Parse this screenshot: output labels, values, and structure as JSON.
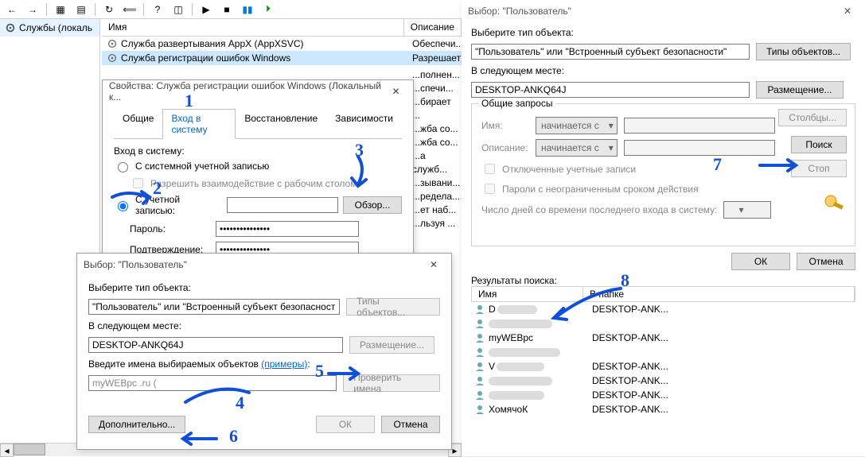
{
  "toolbar_icons": [
    "←",
    "→",
    "|",
    "▦",
    "▤",
    "|",
    "↻",
    "⟸",
    "|",
    "?",
    "◫",
    "|",
    "▶",
    "■",
    "⏸",
    "⏵"
  ],
  "left": {
    "node": "Службы (локаль"
  },
  "svc": {
    "col_name": "Имя",
    "col_desc": "Описание",
    "rows": [
      {
        "name": "Служба развертывания AppX (AppXSVC)",
        "desc": "Обеспечи..."
      },
      {
        "name": "Служба регистрации ошибок Windows",
        "desc": "Разрешает",
        "sel": true
      }
    ],
    "desc_frag": [
      "...полнен...",
      "...спечи...",
      "...бирает ...",
      "...жба со...",
      "...жба со...",
      "...а служб...",
      "...зывани...",
      "...редела...",
      "...ет наб...",
      "...льзуя ..."
    ]
  },
  "props": {
    "title": "Свойства: Служба регистрации ошибок Windows (Локальный к...",
    "tabs": {
      "general": "Общие",
      "logon": "Вход в систему",
      "recovery": "Восстановление",
      "deps": "Зависимости"
    },
    "logon_label": "Вход в систему:",
    "system_acct": "С системной учетной записью",
    "interact": "Разрешить взаимодействие с рабочим столом",
    "this_acct": "С учетной записью:",
    "browse": "Обзор...",
    "password": "Пароль:",
    "confirm": "Подтверждение:",
    "pwd_mask": "●●●●●●●●●●●●●●●"
  },
  "seluser1": {
    "title": "Выбор: \"Пользователь\"",
    "obj_type_lbl": "Выберите тип объекта:",
    "obj_type": "\"Пользователь\" или \"Встроенный субъект безопасности\"",
    "types_btn": "Типы объектов...",
    "loc_lbl": "В следующем месте:",
    "loc": "DESKTOP-ANKQ64J",
    "loc_btn": "Размещение...",
    "names_lbl": "Введите имена выбираемых объектов",
    "examples": "(примеры)",
    "names_val": "myWEBpc .ru (",
    "check_btn": "Проверить имена",
    "advanced": "Дополнительно...",
    "ok": "ОК",
    "cancel": "Отмена"
  },
  "seluser2": {
    "title": "Выбор: \"Пользователь\"",
    "obj_type_lbl": "Выберите тип объекта:",
    "obj_type": "\"Пользователь\" или \"Встроенный субъект безопасности\"",
    "types_btn": "Типы объектов...",
    "loc_lbl": "В следующем месте:",
    "loc": "DESKTOP-ANKQ64J",
    "loc_btn": "Размещение...",
    "common": "Общие запросы",
    "name_lbl": "Имя:",
    "desc_lbl": "Описание:",
    "starts": "начинается с",
    "disabled": "Отключенные учетные записи",
    "nonexp": "Пароли с неограниченным сроком действия",
    "days": "Число дней со времени последнего входа в систему:",
    "cols": "Столбцы...",
    "search": "Поиск",
    "stop": "Стоп",
    "ok": "ОК",
    "cancel": "Отмена",
    "results_lbl": "Результаты поиска:",
    "res_col_name": "Имя",
    "res_col_folder": "В папке",
    "rows": [
      {
        "name": "D",
        "folder": "DESKTOP-ANK..."
      },
      {
        "name": "",
        "folder": ""
      },
      {
        "name": "myWEBpc",
        "folder": "DESKTOP-ANK..."
      },
      {
        "name": "",
        "folder": ""
      },
      {
        "name": "V",
        "folder": "DESKTOP-ANK..."
      },
      {
        "name": "",
        "folder": "DESKTOP-ANK..."
      },
      {
        "name": "",
        "folder": "DESKTOP-ANK..."
      },
      {
        "name": "ХомячоК",
        "folder": "DESKTOP-ANK..."
      }
    ]
  },
  "annotations": {
    "1": "1",
    "2": "2",
    "3": "3",
    "4": "4",
    "5": "5",
    "6": "6",
    "7": "7",
    "8": "8"
  }
}
